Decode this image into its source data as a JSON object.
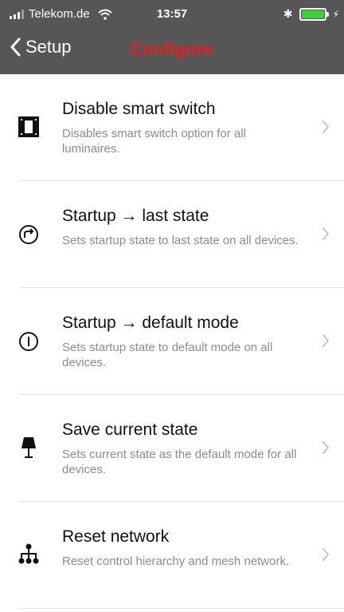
{
  "status_bar": {
    "carrier": "Telekom.de",
    "time": "13:57",
    "bluetooth_symbol": "✱",
    "charging_symbol": "⚡"
  },
  "nav": {
    "back_label": "Setup",
    "title": "Configure",
    "title_color": "#e31e24",
    "header_color": "#565656"
  },
  "items": [
    {
      "title": "Disable smart switch",
      "description": "Disables smart switch option for all luminaires.",
      "icon": "smart-switch-icon"
    },
    {
      "title": "Startup → last state",
      "description": "Sets startup state to last state on all devices.",
      "icon": "startup-last-state-icon"
    },
    {
      "title": "Startup → default mode",
      "description": "Sets startup state to default mode on all devices.",
      "icon": "power-icon"
    },
    {
      "title": "Save current state",
      "description": "Sets current state as the default mode for all devices.",
      "icon": "lamp-icon"
    },
    {
      "title": "Reset network",
      "description": "Reset control hierarchy and mesh network.",
      "icon": "network-hierarchy-icon"
    }
  ]
}
